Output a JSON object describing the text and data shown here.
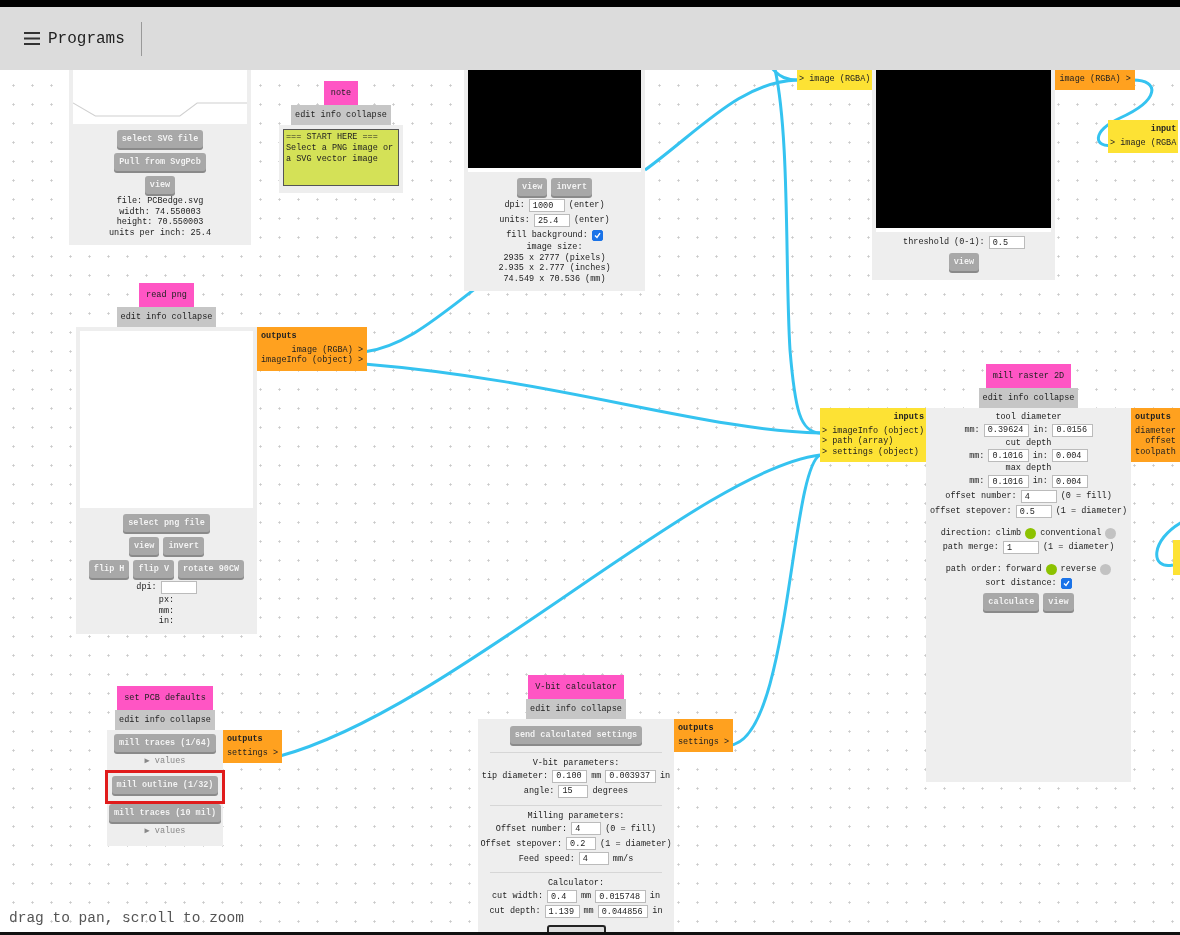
{
  "header": {
    "title": "Programs"
  },
  "nodes": [
    {
      "kind": "module",
      "rows": [
        {
          "kind": "preview_outline"
        },
        {
          "kind": "buttons",
          "buttons": [
            "select SVG file"
          ]
        },
        {
          "kind": "buttons",
          "buttons": [
            "Pull from SvgPcb"
          ]
        },
        {
          "kind": "buttons",
          "buttons": [
            "view"
          ]
        },
        {
          "kind": "text",
          "text": "file: PCBedge.svg"
        },
        {
          "kind": "text",
          "text": "width: 74.550003"
        },
        {
          "kind": "text",
          "text": "height: 70.550003"
        },
        {
          "kind": "text",
          "text": "units per inch: 25.4"
        }
      ]
    },
    {
      "kind": "module",
      "title": "note",
      "toolbar": "edit info collapse",
      "rows": [
        {
          "kind": "note",
          "text": "=== START HERE ===\nSelect a PNG image or\na SVG vector image"
        }
      ]
    },
    {
      "kind": "module",
      "rows": [
        {
          "kind": "preview_dark"
        },
        {
          "kind": "buttons",
          "buttons": [
            "view",
            "invert"
          ]
        },
        {
          "kind": "fields",
          "items": [
            {
              "label": "dpi:",
              "value": "1000",
              "unit": "(enter)"
            }
          ]
        },
        {
          "kind": "fields",
          "items": [
            {
              "label": "units:",
              "value": "25.4",
              "unit": "(enter)"
            }
          ]
        },
        {
          "kind": "check",
          "label": "fill background:",
          "checked": true
        },
        {
          "kind": "text",
          "text": "image size:"
        },
        {
          "kind": "text",
          "text": "2935 x 2777 (pixels)"
        },
        {
          "kind": "text",
          "text": "2.935 x 2.777 (inches)"
        },
        {
          "kind": "text",
          "text": "74.549 x 70.536 (mm)"
        }
      ]
    },
    {
      "kind": "module",
      "inputs": {
        "ports": [
          "> image (RGBA)"
        ]
      },
      "outputs": {
        "ports": [
          "image (RGBA) >"
        ]
      },
      "rows": [
        {
          "kind": "preview_dark"
        },
        {
          "kind": "fields",
          "items": [
            {
              "label": "threshold (0-1):",
              "value": "0.5"
            }
          ]
        },
        {
          "kind": "buttons",
          "buttons": [
            "view"
          ]
        }
      ]
    },
    {
      "kind": "module",
      "inputs": {
        "heading": "input",
        "ports": [
          "> image (RGBA"
        ]
      }
    },
    {
      "kind": "module",
      "title": "read png",
      "toolbar": "edit info collapse",
      "outputs": {
        "heading": "outputs",
        "ports": [
          "image (RGBA) >",
          "imageInfo (object) >"
        ]
      },
      "rows": [
        {
          "kind": "preview_blank"
        },
        {
          "kind": "buttons",
          "buttons": [
            "select png file"
          ]
        },
        {
          "kind": "buttons",
          "buttons": [
            "view",
            "invert"
          ]
        },
        {
          "kind": "buttons",
          "buttons": [
            "flip H",
            "flip V",
            "rotate 90CW"
          ]
        },
        {
          "kind": "fields",
          "items": [
            {
              "label": "dpi:"
            }
          ]
        },
        {
          "kind": "text",
          "text": "px:"
        },
        {
          "kind": "text",
          "text": "mm:"
        },
        {
          "kind": "text",
          "text": "in:"
        }
      ]
    },
    {
      "kind": "module",
      "title": "mill raster 2D",
      "toolbar": "edit info collapse",
      "inputs": {
        "heading": "inputs",
        "ports": [
          "> imageInfo (object)",
          "> path (array)",
          "> settings (object)"
        ]
      },
      "outputs": {
        "heading": "outputs",
        "ports": [
          "diameter",
          "offset",
          "toolpath"
        ]
      },
      "rows": [
        {
          "kind": "text",
          "text": "tool diameter"
        },
        {
          "kind": "fields",
          "items": [
            {
              "label": "mm:",
              "value": "0.39624"
            },
            {
              "label": "in:",
              "value": "0.0156"
            }
          ]
        },
        {
          "kind": "text",
          "text": "cut depth"
        },
        {
          "kind": "fields",
          "items": [
            {
              "label": "mm:",
              "value": "0.1016"
            },
            {
              "label": "in:",
              "value": "0.004"
            }
          ]
        },
        {
          "kind": "text",
          "text": "max depth"
        },
        {
          "kind": "fields",
          "items": [
            {
              "label": "mm:",
              "value": "0.1016"
            },
            {
              "label": "in:",
              "value": "0.004"
            }
          ]
        },
        {
          "kind": "fields",
          "items": [
            {
              "label": "offset number:",
              "value": "4",
              "unit": "(0 = fill)"
            }
          ]
        },
        {
          "kind": "fields",
          "items": [
            {
              "label": "offset stepover:",
              "value": "0.5",
              "unit": "(1 = diameter)"
            }
          ]
        },
        {
          "kind": "radio",
          "label": "direction:",
          "options": [
            {
              "label": "climb",
              "selected": true
            },
            {
              "label": "conventional",
              "selected": false
            }
          ]
        },
        {
          "kind": "fields",
          "items": [
            {
              "label": "path merge:",
              "value": "1",
              "unit": "(1 = diameter)"
            }
          ]
        },
        {
          "kind": "radio",
          "label": "path order:",
          "options": [
            {
              "label": "forward",
              "selected": true
            },
            {
              "label": "reverse",
              "selected": false
            }
          ]
        },
        {
          "kind": "check",
          "label": "sort distance:",
          "checked": true
        },
        {
          "kind": "buttons",
          "buttons": [
            "calculate",
            "view"
          ]
        }
      ]
    },
    {
      "kind": "stub"
    },
    {
      "kind": "module",
      "title": "set PCB defaults",
      "toolbar": "edit info collapse",
      "outputs": {
        "heading": "outputs",
        "ports": [
          "settings >"
        ]
      },
      "rows": [
        {
          "kind": "preset",
          "label": "mill traces (1/64)",
          "values": "▶ values",
          "highlighted": false
        },
        {
          "kind": "preset",
          "label": "mill outline (1/32)",
          "highlighted": true
        },
        {
          "kind": "preset",
          "label": "mill traces (10 mil)",
          "values": "▶ values",
          "highlighted": false
        }
      ]
    },
    {
      "kind": "module",
      "title": "V-bit calculator",
      "toolbar": "edit info collapse",
      "outputs": {
        "heading": "outputs",
        "ports": [
          "settings >"
        ]
      },
      "rows": [
        {
          "kind": "buttons",
          "buttons": [
            "send calculated settings"
          ]
        },
        {
          "kind": "divider"
        },
        {
          "kind": "text",
          "text": "V-bit parameters:"
        },
        {
          "kind": "fields",
          "items": [
            {
              "label": "tip diameter:",
              "value": "0.100",
              "unit": "mm"
            },
            {
              "value": "0.003937",
              "unit": "in"
            }
          ]
        },
        {
          "kind": "fields",
          "items": [
            {
              "label": "angle:",
              "value": "15",
              "unit": "degrees"
            }
          ]
        },
        {
          "kind": "divider"
        },
        {
          "kind": "text",
          "text": "Milling parameters:"
        },
        {
          "kind": "fields",
          "items": [
            {
              "label": "Offset number:",
              "value": "4",
              "unit": "(0 = fill)"
            }
          ]
        },
        {
          "kind": "fields",
          "items": [
            {
              "label": "Offset stepover:",
              "value": "0.2",
              "unit": "(1 = diameter)"
            }
          ]
        },
        {
          "kind": "fields",
          "items": [
            {
              "label": "Feed speed:",
              "value": "4",
              "unit": "mm/s"
            }
          ]
        },
        {
          "kind": "divider"
        },
        {
          "kind": "text",
          "text": "Calculator:"
        },
        {
          "kind": "fields",
          "items": [
            {
              "label": "cut width:",
              "value": "0.4",
              "unit": "mm"
            },
            {
              "value": "0.015748",
              "unit": "in"
            }
          ]
        },
        {
          "kind": "fields",
          "items": [
            {
              "label": "cut depth:",
              "value": "1.139",
              "unit": "mm"
            },
            {
              "value": "0.044856",
              "unit": "in"
            }
          ]
        },
        {
          "kind": "stub_button"
        }
      ]
    }
  ],
  "hint": "drag to pan, scroll to zoom"
}
